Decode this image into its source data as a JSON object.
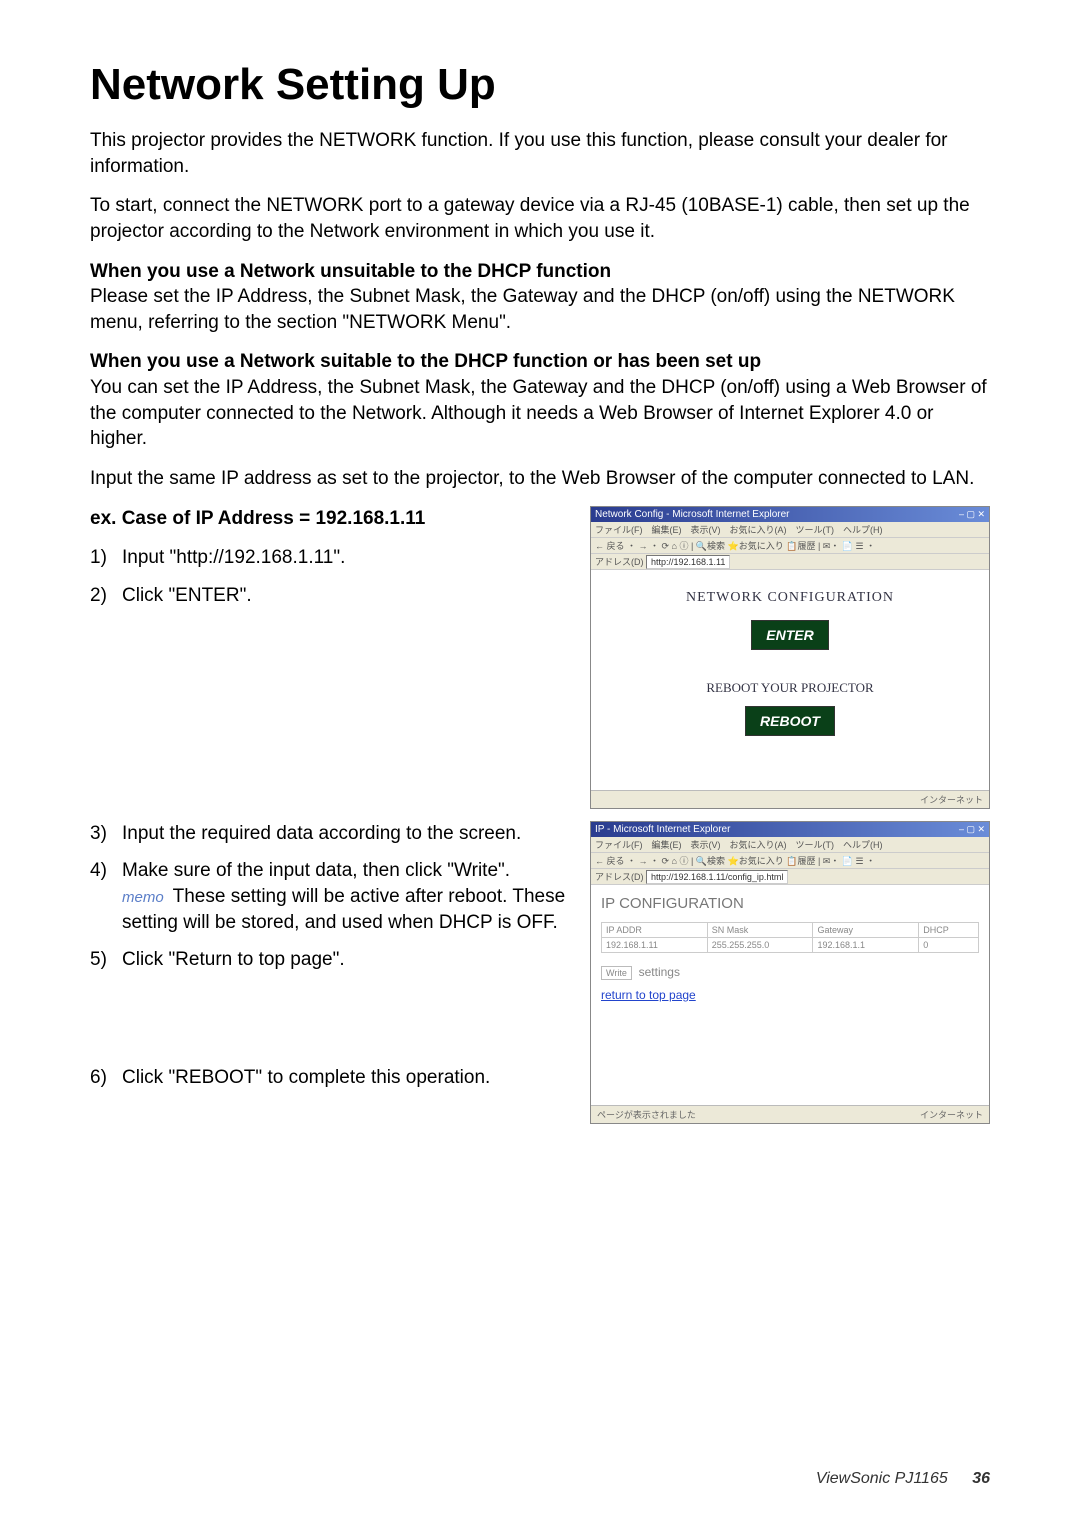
{
  "heading": "Network Setting Up",
  "intro1": "This projector provides the NETWORK function. If you use this function, please consult your dealer for information.",
  "intro2": "To start, connect the NETWORK port to a gateway device via a RJ-45 (10BASE-1) cable, then set up the projector according to the Network environment in which you use it.",
  "subhead1": "When you use a Network unsuitable to the DHCP function",
  "para1": "Please set the IP Address, the Subnet Mask, the Gateway and the DHCP (on/off) using the NETWORK menu, referring to the section \"NETWORK Menu\".",
  "subhead2": "When you use a Network suitable to the DHCP function or has been set up",
  "para2": "You can set the IP Address, the Subnet Mask, the Gateway and the DHCP (on/off) using a Web Browser of the computer connected to the Network. Although it needs a Web Browser of Internet Explorer 4.0 or higher.",
  "para3": "Input the same IP address as set to the projector, to the Web Browser of the computer connected to LAN.",
  "example_heading": "ex. Case of IP Address = 192.168.1.11",
  "steps": {
    "s1_num": "1)",
    "s1_text": "Input \"http://192.168.1.11\".",
    "s2_num": "2)",
    "s2_text": "Click \"ENTER\".",
    "s3_num": "3)",
    "s3_text": "Input the required data according to the screen.",
    "s4_num": "4)",
    "s4_text": "Make sure of the input data, then click \"Write\".",
    "s4_memo_label": "memo",
    "s4_memo": " These setting will be active after reboot. These setting will be stored, and used when DHCP is OFF.",
    "s5_num": "5)",
    "s5_text": "Click \"Return to top page\".",
    "s6_num": "6)",
    "s6_text": "Click \"REBOOT\" to complete this operation."
  },
  "shot1": {
    "title": "Network Config - Microsoft Internet Explorer",
    "netconf": "NETWORK CONFIGURATION",
    "enter": "ENTER",
    "reboot_text": "REBOOT YOUR PROJECTOR",
    "reboot": "REBOOT",
    "status_right": "インターネット"
  },
  "shot2": {
    "title": "IP - Microsoft Internet Explorer",
    "heading": "IP CONFIGURATION",
    "col1": "IP ADDR",
    "col2": "SN Mask",
    "col3": "Gateway",
    "col4": "DHCP",
    "row1": "192.168.1.11",
    "row2": "255.255.255.0",
    "row3": "192.168.1.1",
    "row4": "0",
    "write": "Write",
    "settings": "settings",
    "return": "return to top page",
    "status_left": "ページが表示されました",
    "status_right": "インターネット"
  },
  "footer": {
    "product": "ViewSonic  PJ1165",
    "page": "36"
  }
}
